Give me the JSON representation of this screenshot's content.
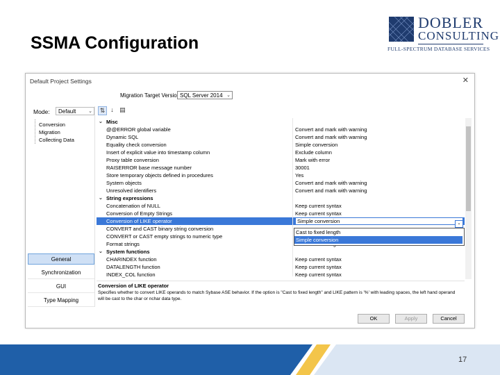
{
  "slide": {
    "title": "SSMA Configuration",
    "page_number": "17"
  },
  "logo": {
    "line1": "DOBLER",
    "line2": "CONSULTING",
    "tagline": "FULL-SPECTRUM DATABASE SERVICES"
  },
  "dialog": {
    "title": "Default Project Settings",
    "close_glyph": "✕",
    "target_label": "Migration Target Version",
    "target_value": "SQL Server 2014",
    "model_label": "Mode:",
    "model_value": "Default",
    "tree": [
      "Conversion",
      "Migration",
      "Collecting Data"
    ],
    "nav": [
      "General",
      "Synchronization",
      "GUI",
      "Type Mapping"
    ],
    "rows": [
      {
        "type": "cat",
        "toggle": "⌄",
        "name": "Misc",
        "val": ""
      },
      {
        "type": "item",
        "name": "@@ERROR global variable",
        "val": "Convert and mark with warning"
      },
      {
        "type": "item",
        "name": "Dynamic SQL",
        "val": "Convert and mark with warning"
      },
      {
        "type": "item",
        "name": "Equality check conversion",
        "val": "Simple conversion"
      },
      {
        "type": "item",
        "name": "Insert of explicit value into timestamp column",
        "val": "Exclude column"
      },
      {
        "type": "item",
        "name": "Proxy table conversion",
        "val": "Mark with error"
      },
      {
        "type": "item",
        "name": "RAISERROR base message number",
        "val": "30001"
      },
      {
        "type": "item",
        "name": "Store temporary objects defined in procedures",
        "val": "Yes"
      },
      {
        "type": "item",
        "name": "System objects",
        "val": "Convert and mark with warning"
      },
      {
        "type": "item",
        "name": "Unresolved identifiers",
        "val": "Convert and mark with warning"
      },
      {
        "type": "cat",
        "toggle": "⌄",
        "name": "String expressions",
        "val": ""
      },
      {
        "type": "item",
        "name": "Concatenation of NULL",
        "val": "Keep current syntax"
      },
      {
        "type": "item",
        "name": "Conversion of Empty Strings",
        "val": "Keep current syntax"
      },
      {
        "type": "sel",
        "name": "Conversion of LIKE operator",
        "val": "Simple conversion"
      },
      {
        "type": "item",
        "name": "CONVERT and CAST binary string conversion",
        "val": ""
      },
      {
        "type": "item",
        "name": "CONVERT or CAST empty strings to numeric type",
        "val": ""
      },
      {
        "type": "item",
        "name": "Format strings",
        "val": "Create new string"
      },
      {
        "type": "cat",
        "toggle": "⌄",
        "name": "System functions",
        "val": ""
      },
      {
        "type": "item",
        "name": "CHARINDEX function",
        "val": "Keep current syntax"
      },
      {
        "type": "item",
        "name": "DATALENGTH function",
        "val": "Keep current syntax"
      },
      {
        "type": "item",
        "name": "INDEX_COL function",
        "val": "Keep current syntax"
      }
    ],
    "dropdown_options": [
      "Cast to fixed length",
      "Simple conversion"
    ],
    "dropdown_highlight_index": 1,
    "description_title": "Conversion of LIKE operator",
    "description_text": "Specifies whether to convert LIKE operands to match Sybase ASE behavior. If the option is \"Cast to fixed length\" and LIKE pattern is '%' with leading spaces, the left hand operand will be cast to the char or nchar data type.",
    "buttons": {
      "ok": "OK",
      "apply": "Apply",
      "cancel": "Cancel"
    }
  },
  "colors": {
    "selection": "#3a78d8",
    "brand_navy": "#1f3b6e",
    "footer_blue": "#1f5fa8",
    "footer_gold": "#f3c54a"
  }
}
